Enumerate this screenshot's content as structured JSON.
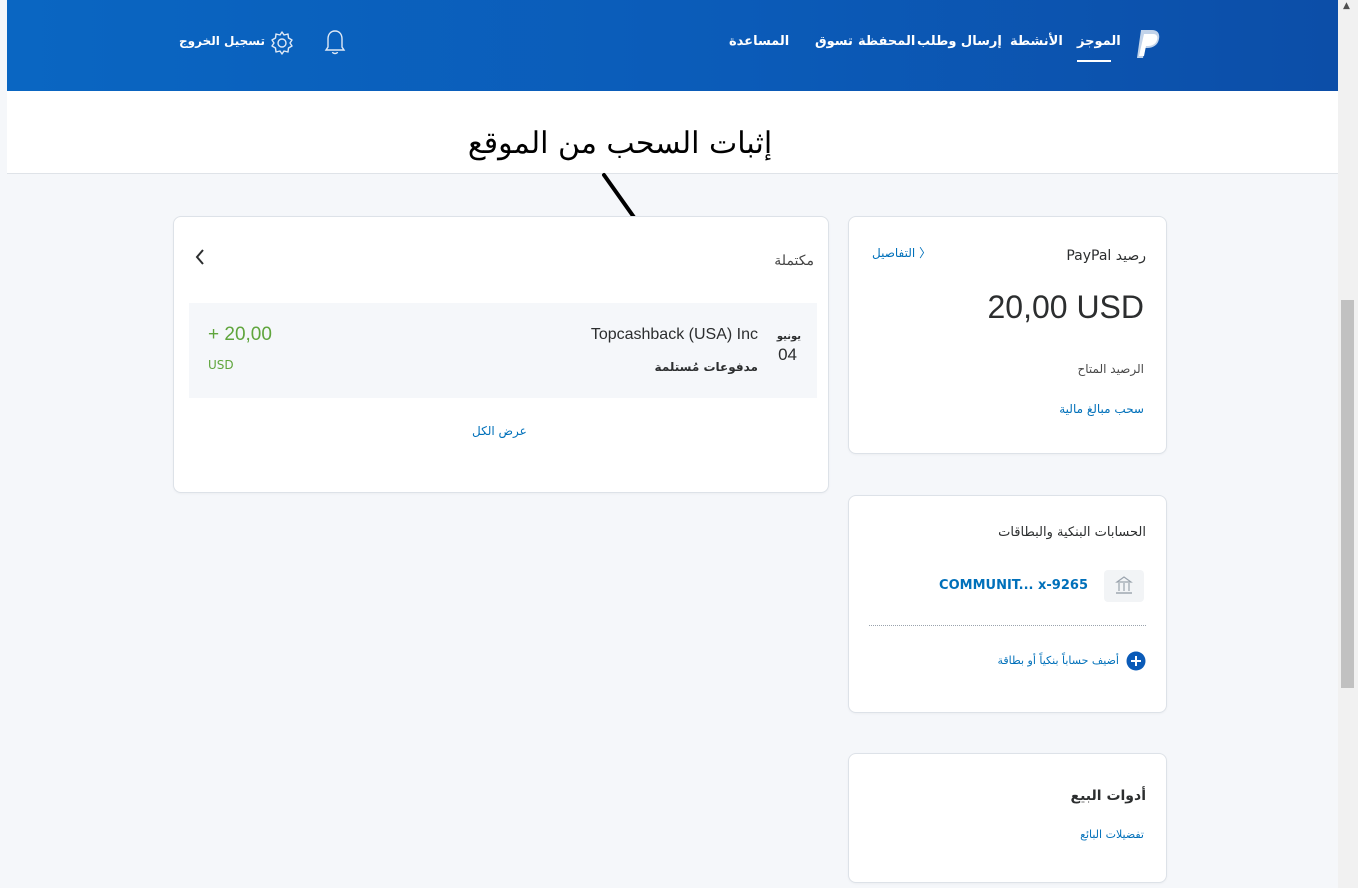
{
  "nav": {
    "summary": "الموجز",
    "activity": "الأنشطة",
    "send_request": "إرسال وطلب",
    "wallet": "المحفظة",
    "shop": "تسوق",
    "help": "المساعدة",
    "logout": "تسجيل الخروج",
    "notification_icon": "bell-icon",
    "settings_icon": "gear-icon",
    "logo_icon": "paypal-logo-icon"
  },
  "annotation": {
    "title": "إثبات السحب من الموقع"
  },
  "balance_card": {
    "title": "رصيد PayPal",
    "details_link": "التفاصيل",
    "amount": "20,00 USD",
    "available_label": "الرصيد المتاح",
    "withdraw_link": "سحب مبالغ مالية"
  },
  "bank_card": {
    "title": "الحسابات البنكية والبطاقات",
    "account_name": "COMMUNIT...",
    "account_suffix": "x-9265",
    "bank_icon": "bank-icon",
    "add_link": "أضيف حساباً بنكياً أو بطاقة",
    "add_icon": "plus-circle-icon"
  },
  "seller_card": {
    "title": "أدوات البيع",
    "prefs_link": "تفضيلات البائع"
  },
  "activity_card": {
    "status": "مكتملة",
    "nav_icon": "chevron-left-icon",
    "transaction": {
      "month": "يونيو",
      "day": "04",
      "merchant": "Topcashback (USA) Inc",
      "type": "مدفوعات مُستلمة",
      "amount": "+ 20,00",
      "currency": "USD"
    },
    "view_all": "عرض الكل"
  },
  "colors": {
    "header": "#0b5bb8",
    "link": "#0070ba",
    "positive": "#5fa53c"
  }
}
